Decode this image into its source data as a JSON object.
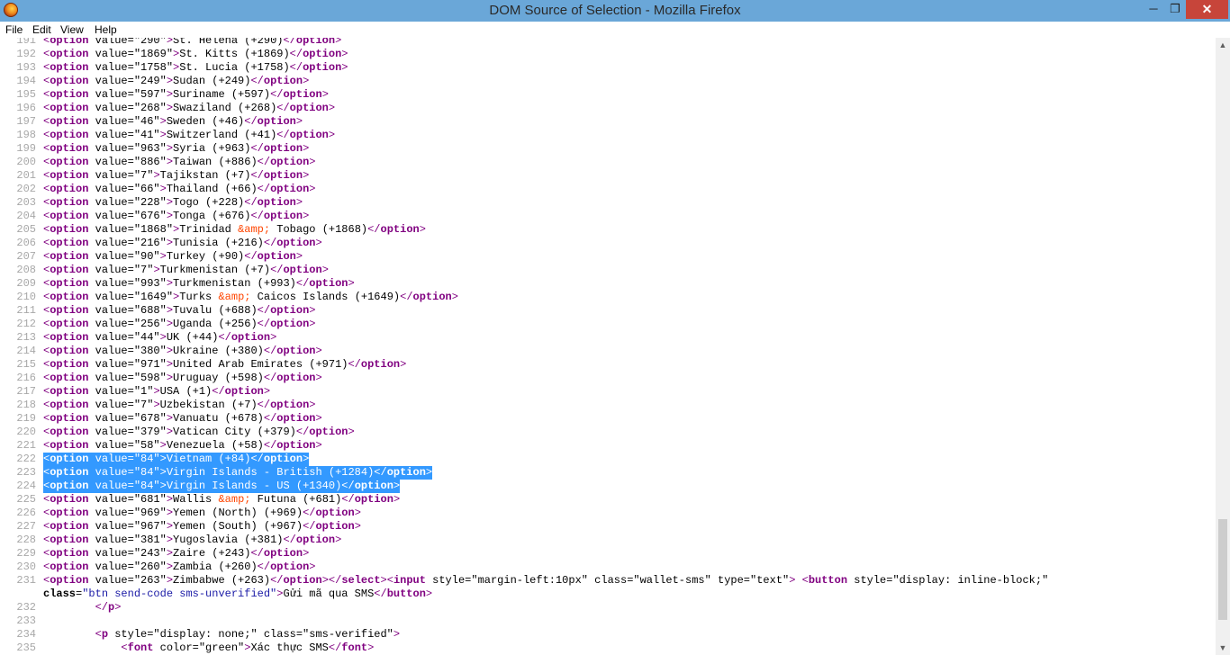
{
  "window": {
    "title": "DOM Source of Selection - Mozilla Firefox",
    "min_glyph": "─",
    "max_glyph": "❐",
    "close_glyph": "✕"
  },
  "menu": {
    "file": "File",
    "edit": "Edit",
    "view": "View",
    "help": "Help"
  },
  "colors": {
    "titlebar": "#6aa7d8",
    "close_button": "#c7453a",
    "selection": "#3399ff",
    "tag": "#800080",
    "attr_value": "#1a1aa6",
    "entity": "#ff4500"
  },
  "icons": {
    "app": "firefox-icon",
    "scroll_up": "chevron-up-icon",
    "scroll_down": "chevron-down-icon"
  },
  "source": {
    "selected_lines": [
      222,
      223,
      224
    ],
    "lines": [
      {
        "n": "191",
        "html": "<option value=\"290\">St. Helena (+290)</option>"
      },
      {
        "n": "192",
        "html": "<option value=\"1869\">St. Kitts (+1869)</option>"
      },
      {
        "n": "193",
        "html": "<option value=\"1758\">St. Lucia (+1758)</option>"
      },
      {
        "n": "194",
        "html": "<option value=\"249\">Sudan (+249)</option>"
      },
      {
        "n": "195",
        "html": "<option value=\"597\">Suriname (+597)</option>"
      },
      {
        "n": "196",
        "html": "<option value=\"268\">Swaziland (+268)</option>"
      },
      {
        "n": "197",
        "html": "<option value=\"46\">Sweden (+46)</option>"
      },
      {
        "n": "198",
        "html": "<option value=\"41\">Switzerland (+41)</option>"
      },
      {
        "n": "199",
        "html": "<option value=\"963\">Syria (+963)</option>"
      },
      {
        "n": "200",
        "html": "<option value=\"886\">Taiwan (+886)</option>"
      },
      {
        "n": "201",
        "html": "<option value=\"7\">Tajikstan (+7)</option>"
      },
      {
        "n": "202",
        "html": "<option value=\"66\">Thailand (+66)</option>"
      },
      {
        "n": "203",
        "html": "<option value=\"228\">Togo (+228)</option>"
      },
      {
        "n": "204",
        "html": "<option value=\"676\">Tonga (+676)</option>"
      },
      {
        "n": "205",
        "html": "<option value=\"1868\">Trinidad &amp; Tobago (+1868)</option>"
      },
      {
        "n": "206",
        "html": "<option value=\"216\">Tunisia (+216)</option>"
      },
      {
        "n": "207",
        "html": "<option value=\"90\">Turkey (+90)</option>"
      },
      {
        "n": "208",
        "html": "<option value=\"7\">Turkmenistan (+7)</option>"
      },
      {
        "n": "209",
        "html": "<option value=\"993\">Turkmenistan (+993)</option>"
      },
      {
        "n": "210",
        "html": "<option value=\"1649\">Turks &amp; Caicos Islands (+1649)</option>"
      },
      {
        "n": "211",
        "html": "<option value=\"688\">Tuvalu (+688)</option>"
      },
      {
        "n": "212",
        "html": "<option value=\"256\">Uganda (+256)</option>"
      },
      {
        "n": "213",
        "html": "<option value=\"44\">UK (+44)</option>"
      },
      {
        "n": "214",
        "html": "<option value=\"380\">Ukraine (+380)</option>"
      },
      {
        "n": "215",
        "html": "<option value=\"971\">United Arab Emirates (+971)</option>"
      },
      {
        "n": "216",
        "html": "<option value=\"598\">Uruguay (+598)</option>"
      },
      {
        "n": "217",
        "html": "<option value=\"1\">USA (+1)</option>"
      },
      {
        "n": "218",
        "html": "<option value=\"7\">Uzbekistan (+7)</option>"
      },
      {
        "n": "219",
        "html": "<option value=\"678\">Vanuatu (+678)</option>"
      },
      {
        "n": "220",
        "html": "<option value=\"379\">Vatican City (+379)</option>"
      },
      {
        "n": "221",
        "html": "<option value=\"58\">Venezuela (+58)</option>"
      },
      {
        "n": "222",
        "html": "<option value=\"84\">Vietnam (+84)</option>"
      },
      {
        "n": "223",
        "html": "<option value=\"84\">Virgin Islands - British (+1284)</option>"
      },
      {
        "n": "224",
        "html": "<option value=\"84\">Virgin Islands - US (+1340)</option>"
      },
      {
        "n": "225",
        "html": "<option value=\"681\">Wallis &amp; Futuna (+681)</option>"
      },
      {
        "n": "226",
        "html": "<option value=\"969\">Yemen (North) (+969)</option>"
      },
      {
        "n": "227",
        "html": "<option value=\"967\">Yemen (South) (+967)</option>"
      },
      {
        "n": "228",
        "html": "<option value=\"381\">Yugoslavia (+381)</option>"
      },
      {
        "n": "229",
        "html": "<option value=\"243\">Zaire (+243)</option>"
      },
      {
        "n": "230",
        "html": "<option value=\"260\">Zambia (+260)</option>"
      },
      {
        "n": "231",
        "html": "<option value=\"263\">Zimbabwe (+263)</option></select><input style=\"margin-left:10px\" class=\"wallet-sms\" type=\"text\"> <button style=\"display: inline-block;\""
      },
      {
        "n": "",
        "html": "class=\"btn send-code sms-unverified\">Gửi mã qua SMS</button>"
      },
      {
        "n": "232",
        "html": "        </p>"
      },
      {
        "n": "233",
        "html": ""
      },
      {
        "n": "234",
        "html": "        <p style=\"display: none;\" class=\"sms-verified\">"
      },
      {
        "n": "235",
        "html": "            <font color=\"green\">Xác thực SMS</font>"
      }
    ]
  }
}
